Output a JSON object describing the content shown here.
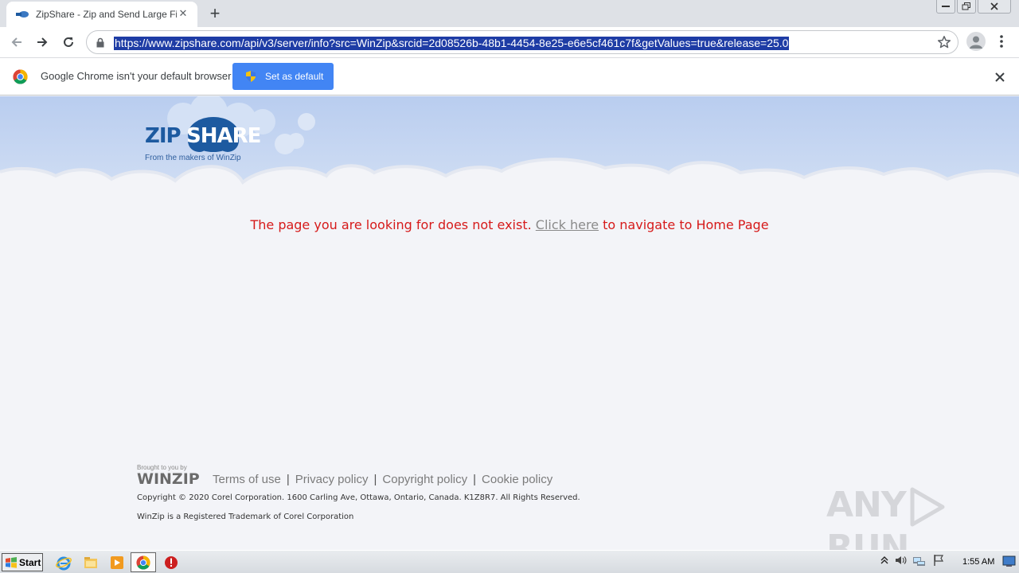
{
  "browser": {
    "tab": {
      "title": "ZipShare - Zip and Send Large Files"
    },
    "address_bar": {
      "url": "https://www.zipshare.com/api/v3/server/info?src=WinZip&srcid=2d08526b-48b1-4454-8e25-e6e5cf461c7f&getValues=true&release=25.0"
    },
    "infobar": {
      "message": "Google Chrome isn't your default browser",
      "button_label": "Set as default"
    }
  },
  "page": {
    "logo": {
      "left": "ZIP",
      "right": "SHARE",
      "tagline": "From the makers of WinZip"
    },
    "error": {
      "prefix": "The page you are looking for does not exist.",
      "link_text": "Click here",
      "suffix": "to navigate to Home Page"
    },
    "footer": {
      "brought_by": "Brought to you by",
      "brand": "WINZIP",
      "links": [
        "Terms of use",
        "Privacy policy",
        "Copyright policy",
        "Cookie policy"
      ],
      "copyright": "Copyright © 2020 Corel Corporation. 1600 Carling Ave, Ottawa, Ontario, Canada. K1Z8R7. All Rights Reserved.",
      "trademark": "WinZip is a Registered Trademark of Corel Corporation"
    },
    "watermark": {
      "left": "ANY",
      "right": "RUN"
    }
  },
  "taskbar": {
    "start_label": "Start",
    "clock": "1:55 AM"
  },
  "colors": {
    "url_highlight": "#1e3ca5",
    "primary_button": "#4285f4",
    "error_text": "#d61a1a",
    "logo_blue": "#1d5aa0"
  }
}
